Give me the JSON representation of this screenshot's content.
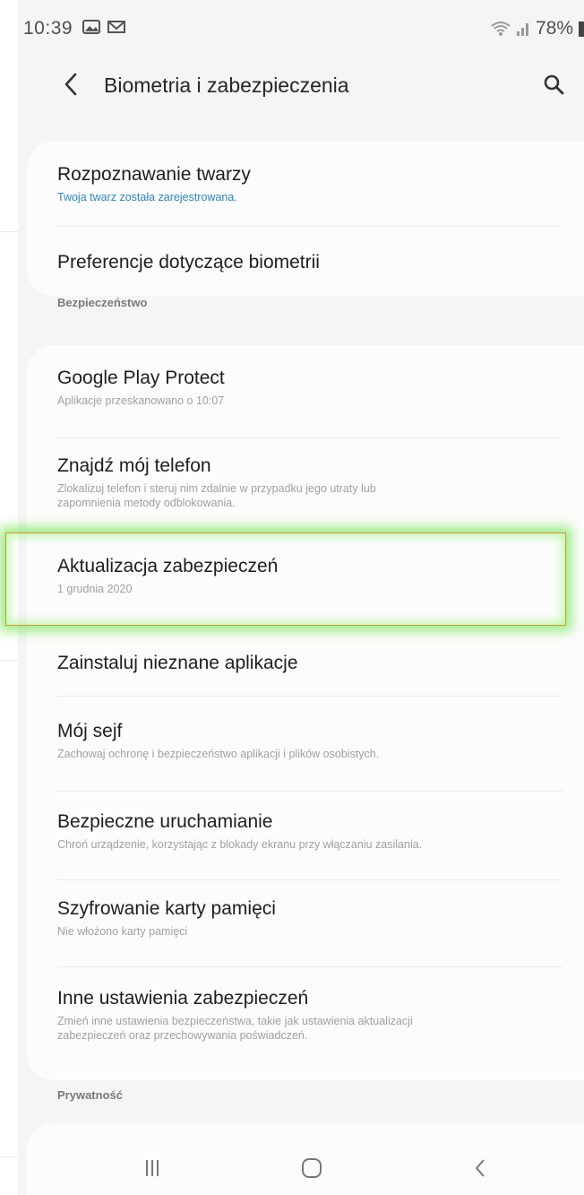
{
  "status_bar": {
    "time": "10:39",
    "battery": "78%",
    "icons": [
      "gallery-icon",
      "mail-icon",
      "wifi-icon",
      "signal-icon",
      "battery-icon"
    ]
  },
  "app_bar": {
    "title": "Biometria i zabezpieczenia",
    "back_icon": "chevron-left-icon",
    "search_icon": "search-icon"
  },
  "biometrics": [
    {
      "title": "Rozpoznawanie twarzy",
      "subtitle": "Twoja twarz została zarejestrowana."
    },
    {
      "title": "Preferencje dotyczące biometrii"
    }
  ],
  "security_section": {
    "header": "Bezpieczeństwo",
    "items": [
      {
        "title": "Google Play Protect",
        "subtitle": "Aplikacje przeskanowano o 10:07"
      },
      {
        "title": "Znajdź mój telefon",
        "subtitle_line1": "Zlokalizuj telefon i steruj nim zdalnie w przypadku jego utraty lub",
        "subtitle_line2": "zapomnienia metody odblokowania."
      },
      {
        "title": "Aktualizacja zabezpieczeń",
        "subtitle": "1 grudnia 2020"
      },
      {
        "title": "Zainstaluj nieznane aplikacje"
      },
      {
        "title": "Mój sejf",
        "subtitle": "Zachowaj ochronę i bezpieczeństwo aplikacji i plików osobistych."
      },
      {
        "title": "Bezpieczne uruchamianie",
        "subtitle": "Chroń urządzenie, korzystając z blokady ekranu przy włączaniu zasilania."
      },
      {
        "title": "Szyfrowanie karty pamięci",
        "subtitle": "Nie włożono karty pamięci"
      },
      {
        "title": "Inne ustawienia zabezpieczeń",
        "subtitle_line1": "Zmień inne ustawienia bezpieczeństwa, takie jak ustawienia aktualizacji",
        "subtitle_line2": "zabezpieczeń oraz przechowywania poświadczeń."
      }
    ]
  },
  "privacy_section": {
    "header": "Prywatność"
  },
  "nav_bar": {
    "icons": [
      "recent-apps-icon",
      "home-icon",
      "back-icon"
    ]
  },
  "colors": {
    "accent_link": "#2c84c7",
    "highlight_border": "#d39a2b",
    "highlight_glow": "#78e65a",
    "background": "#f5f5f5",
    "card": "#fcfcfc"
  }
}
